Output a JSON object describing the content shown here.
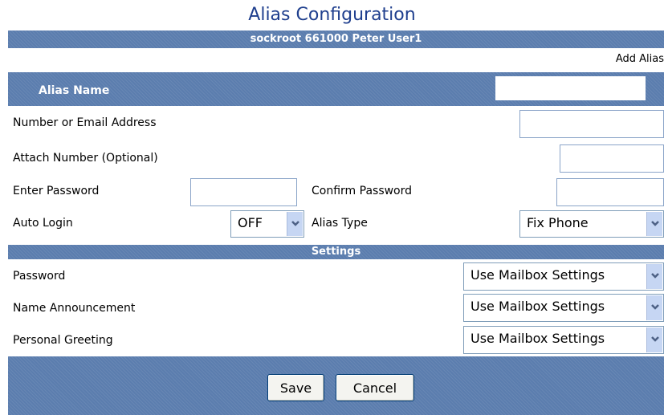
{
  "page_title": "Alias Configuration",
  "header_info": "sockroot 661000  Peter User1",
  "add_alias_label": "Add Alias",
  "alias_name_label": "Alias Name",
  "alias_name_value": "",
  "fields": {
    "number_email_label": "Number or Email Address",
    "number_email_value": "",
    "attach_number_label": "Attach Number (Optional)",
    "attach_number_value": "",
    "enter_password_label": "Enter Password",
    "enter_password_value": "",
    "confirm_password_label": "Confirm Password",
    "confirm_password_value": "",
    "auto_login_label": "Auto Login",
    "auto_login_value": "OFF",
    "alias_type_label": "Alias Type",
    "alias_type_value": "Fix Phone"
  },
  "settings": {
    "title": "Settings",
    "password_label": "Password",
    "password_value": "Use Mailbox Settings",
    "name_announcement_label": "Name Announcement",
    "name_announcement_value": "Use Mailbox Settings",
    "personal_greeting_label": "Personal Greeting",
    "personal_greeting_value": "Use Mailbox Settings"
  },
  "buttons": {
    "save": "Save",
    "cancel": "Cancel"
  },
  "colors": {
    "title": "#1f3f8e",
    "band": "#5b7dae",
    "dropdown_button": "#c6d6f3"
  },
  "icons": {
    "dropdown": "chevron-down-icon"
  }
}
